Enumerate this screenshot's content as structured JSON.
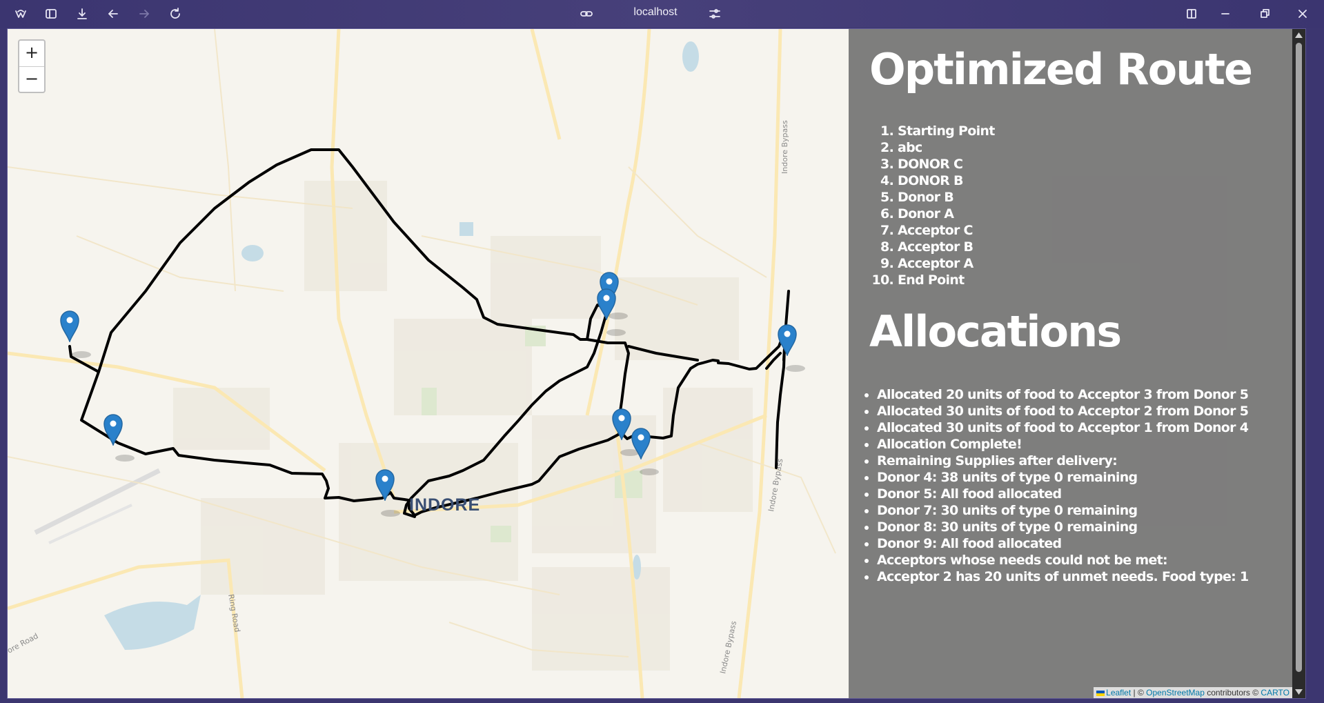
{
  "browser": {
    "url": "localhost",
    "controls": [
      "app-logo-icon",
      "sidebar-toggle-icon",
      "download-icon",
      "back-icon",
      "forward-icon",
      "reload-icon",
      "link-icon",
      "page-settings-icon",
      "split-view-icon",
      "minimize-icon",
      "restore-icon",
      "close-icon"
    ]
  },
  "map": {
    "zoom_in": "+",
    "zoom_out": "−",
    "city_label": "INDORE",
    "road_labels": [
      "Indore Bypass",
      "Ring Road",
      "Indore Bypass",
      "Indore Bypass",
      "ore Road"
    ],
    "route_color": "#000000",
    "marker_color": "#2a81cb",
    "marker_count": 8
  },
  "panel": {
    "route_title": "Optimized Route",
    "route": [
      "Starting Point",
      "abc",
      "DONOR C",
      "DONOR B",
      "Donor B",
      "Donor A",
      "Acceptor C",
      "Acceptor B",
      "Acceptor A",
      "End Point"
    ],
    "allocations_title": "Allocations",
    "allocations": [
      "Allocated 20 units of food to Acceptor 3 from Donor 5",
      "Allocated 30 units of food to Acceptor 2 from Donor 5",
      "Allocated 30 units of food to Acceptor 1 from Donor 4",
      "Allocation Complete!",
      "Remaining Supplies after delivery:",
      "Donor 4: 38 units of type 0 remaining",
      "Donor 5: All food allocated",
      "Donor 7: 30 units of type 0 remaining",
      "Donor 8: 30 units of type 0 remaining",
      "Donor 9: All food allocated",
      "Acceptors whose needs could not be met:",
      "Acceptor 2 has 20 units of unmet needs. Food type: 1"
    ]
  },
  "attribution": {
    "leaflet": "Leaflet",
    "sep1": " | © ",
    "osm": "OpenStreetMap",
    "mid": " contributors © ",
    "carto": "CARTO"
  }
}
